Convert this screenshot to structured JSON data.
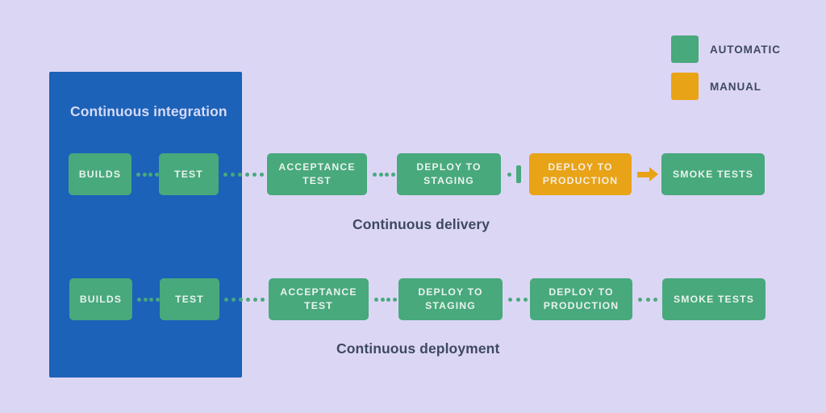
{
  "diagram": {
    "background_color": "#dcd6f5",
    "colors": {
      "automatic": "#48a97c",
      "manual": "#e8a317",
      "ci_panel": "#1b62b8",
      "text_dark": "#3e4a5d",
      "text_light": "#d7d9f7"
    }
  },
  "legend": {
    "items": [
      {
        "label": "AUTOMATIC",
        "color": "#48a97c"
      },
      {
        "label": "MANUAL",
        "color": "#e8a317"
      }
    ]
  },
  "ci_panel": {
    "title": "Continuous integration"
  },
  "rows": [
    {
      "caption": "Continuous delivery",
      "nodes": [
        {
          "label": "BUILDS",
          "kind": "automatic"
        },
        {
          "label": "TEST",
          "kind": "automatic"
        },
        {
          "label": "ACCEPTANCE TEST",
          "line1": "ACCEPTANCE",
          "line2": "TEST",
          "kind": "automatic"
        },
        {
          "label": "DEPLOY TO STAGING",
          "line1": "DEPLOY TO",
          "line2": "STAGING",
          "kind": "automatic"
        },
        {
          "label": "DEPLOY TO PRODUCTION",
          "line1": "DEPLOY TO",
          "line2": "PRODUCTION",
          "kind": "manual"
        },
        {
          "label": "SMOKE TESTS",
          "kind": "automatic"
        }
      ]
    },
    {
      "caption": "Continuous deployment",
      "nodes": [
        {
          "label": "BUILDS",
          "kind": "automatic"
        },
        {
          "label": "TEST",
          "kind": "automatic"
        },
        {
          "label": "ACCEPTANCE TEST",
          "line1": "ACCEPTANCE",
          "line2": "TEST",
          "kind": "automatic"
        },
        {
          "label": "DEPLOY TO STAGING",
          "line1": "DEPLOY TO",
          "line2": "STAGING",
          "kind": "automatic"
        },
        {
          "label": "DEPLOY TO PRODUCTION",
          "line1": "DEPLOY TO",
          "line2": "PRODUCTION",
          "kind": "automatic"
        },
        {
          "label": "SMOKE TESTS",
          "kind": "automatic"
        }
      ]
    }
  ]
}
